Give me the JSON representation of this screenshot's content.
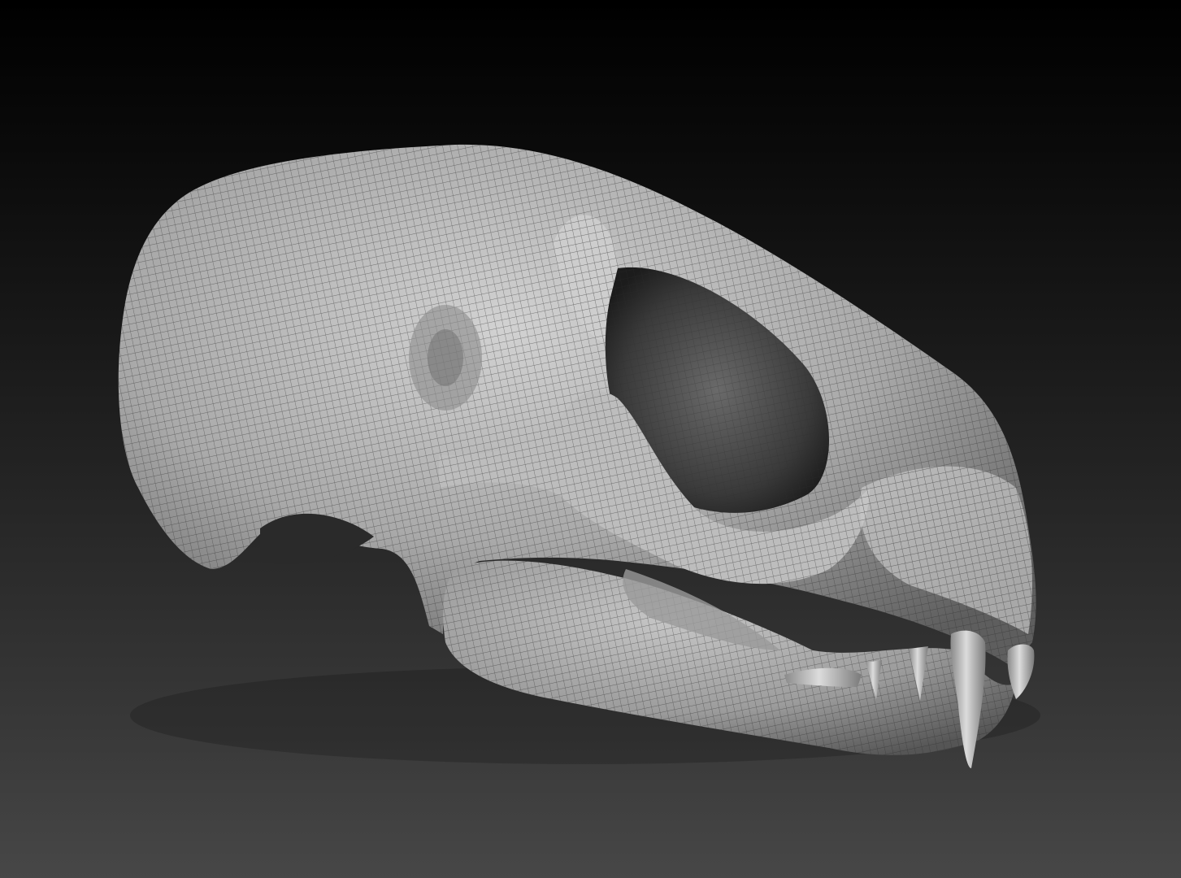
{
  "viewport": {
    "background_top": "#000000",
    "background_bottom": "#474747"
  },
  "model": {
    "subject": "skull-mesh",
    "surface_color": "#b9b9b9",
    "wireframe_color": "#3a3a3a",
    "shading": "matcap-gray"
  }
}
